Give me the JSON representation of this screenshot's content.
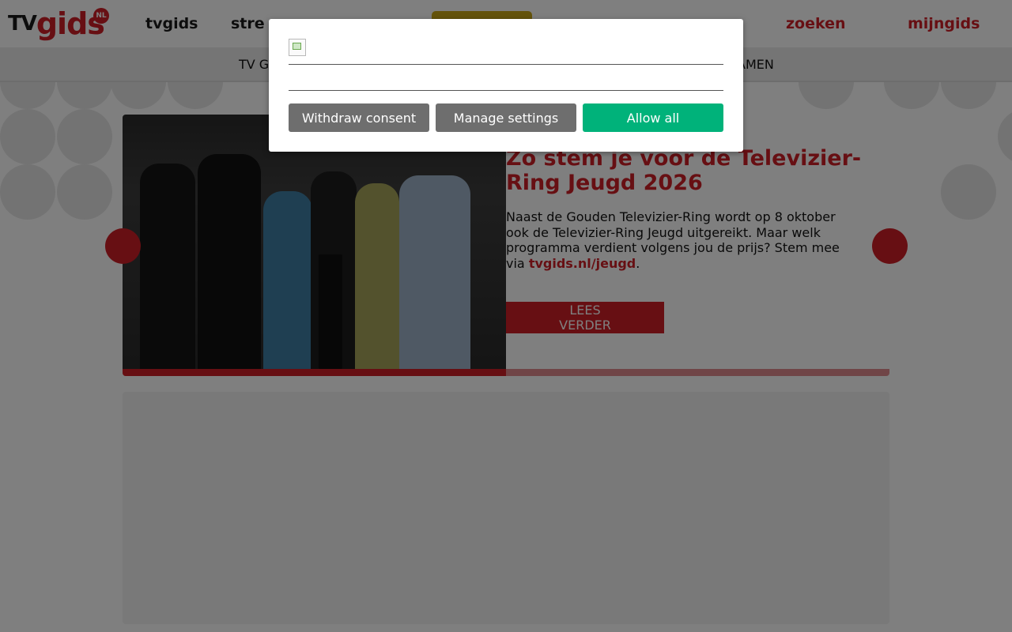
{
  "header": {
    "logo_tv": "TV",
    "logo_gids": "gids",
    "logo_badge": "NL",
    "nav": [
      {
        "icon": "",
        "label": "tvgids"
      },
      {
        "icon": "",
        "label": "stre"
      }
    ],
    "search_icon": "",
    "search_label": "zoeken",
    "notification_icon": "",
    "account_icon": "",
    "account_label": "mijngids"
  },
  "subnav": {
    "first_label": "TV G",
    "last_label": "AMEN"
  },
  "hero": {
    "title": "Zo stem je voor de Televizier-Ring Jeugd 2026",
    "body_text": "Naast de Gouden Televizier-Ring wordt op 8 oktober ook de Televizier-Ring Jeugd uitgereikt. Maar welk programma verdient volgens jou de prijs? Stem mee via ",
    "body_link": "tvgids.nl/jeugd",
    "body_end": ".",
    "button_label": "LEES VERDER",
    "prev_icon": "",
    "next_icon": "",
    "progress": 0.5
  },
  "consent": {
    "withdraw_label": "Withdraw consent",
    "manage_label": "Manage settings",
    "allow_label": "Allow all"
  },
  "colors": {
    "brand_red": "#cf1f26",
    "accept_green": "#00b27a",
    "secondary_gray": "#6e6e6e"
  }
}
